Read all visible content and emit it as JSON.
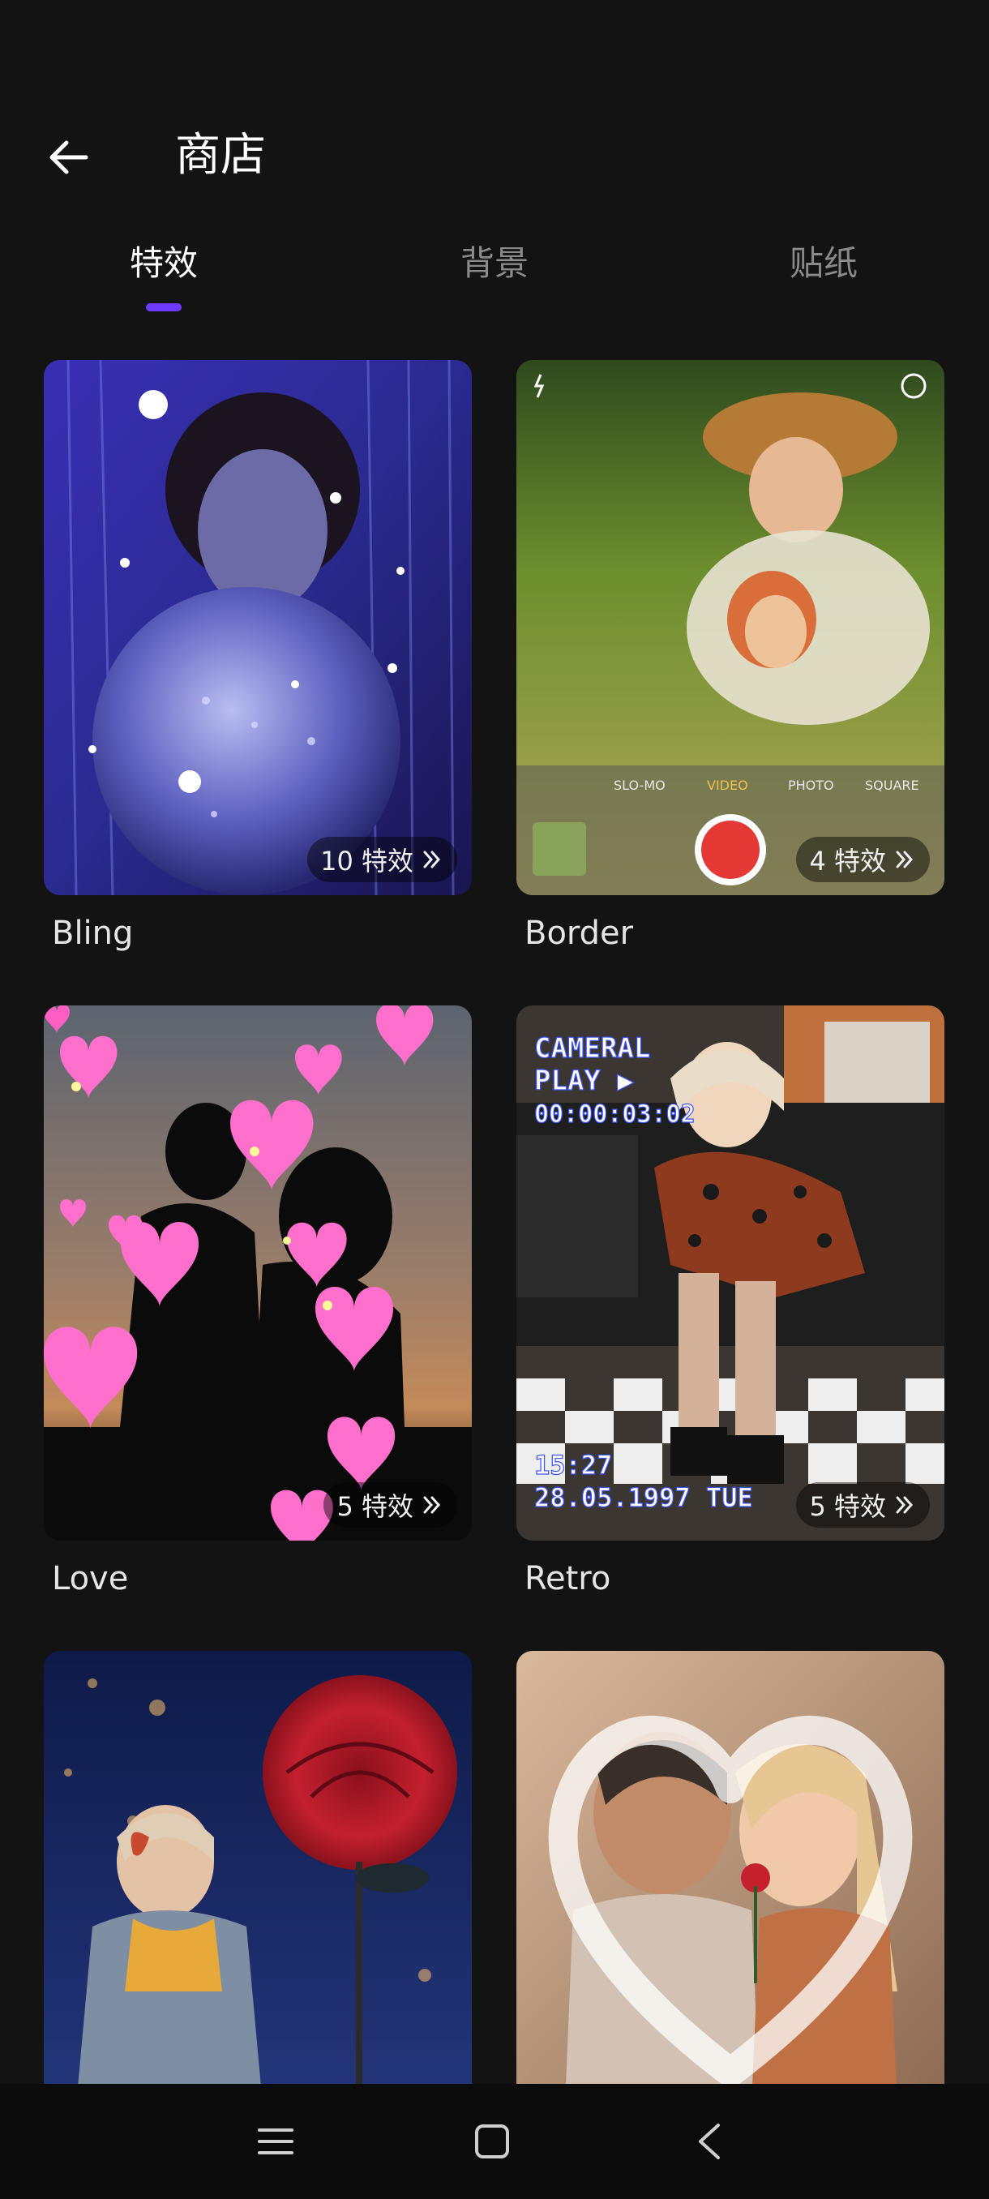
{
  "header": {
    "title": "商店"
  },
  "tabs": [
    {
      "label": "特效",
      "active": true
    },
    {
      "label": "背景",
      "active": false
    },
    {
      "label": "贴纸",
      "active": false
    }
  ],
  "cards": [
    {
      "name": "Bling",
      "count": "10 特效"
    },
    {
      "name": "Border",
      "count": "4 特效"
    },
    {
      "name": "Love",
      "count": "5 特效"
    },
    {
      "name": "Retro",
      "count": "5 特效"
    },
    {
      "name": "",
      "count": ""
    },
    {
      "name": "",
      "count": ""
    }
  ],
  "overlays": {
    "border_modes": [
      "SLO-MO",
      "VIDEO",
      "PHOTO",
      "SQUARE"
    ],
    "retro_top": [
      "CAMERAL",
      "PLAY ▶",
      "00:00:03:02"
    ],
    "retro_bottom": [
      "15:27",
      "28.05.1997 TUE"
    ]
  },
  "colors": {
    "accent": "#6c3bff",
    "background": "#131313"
  },
  "icons": [
    "arrow-left-icon",
    "chevron-double-right-icon",
    "menu-icon",
    "home-square-icon",
    "back-triangle-icon"
  ]
}
